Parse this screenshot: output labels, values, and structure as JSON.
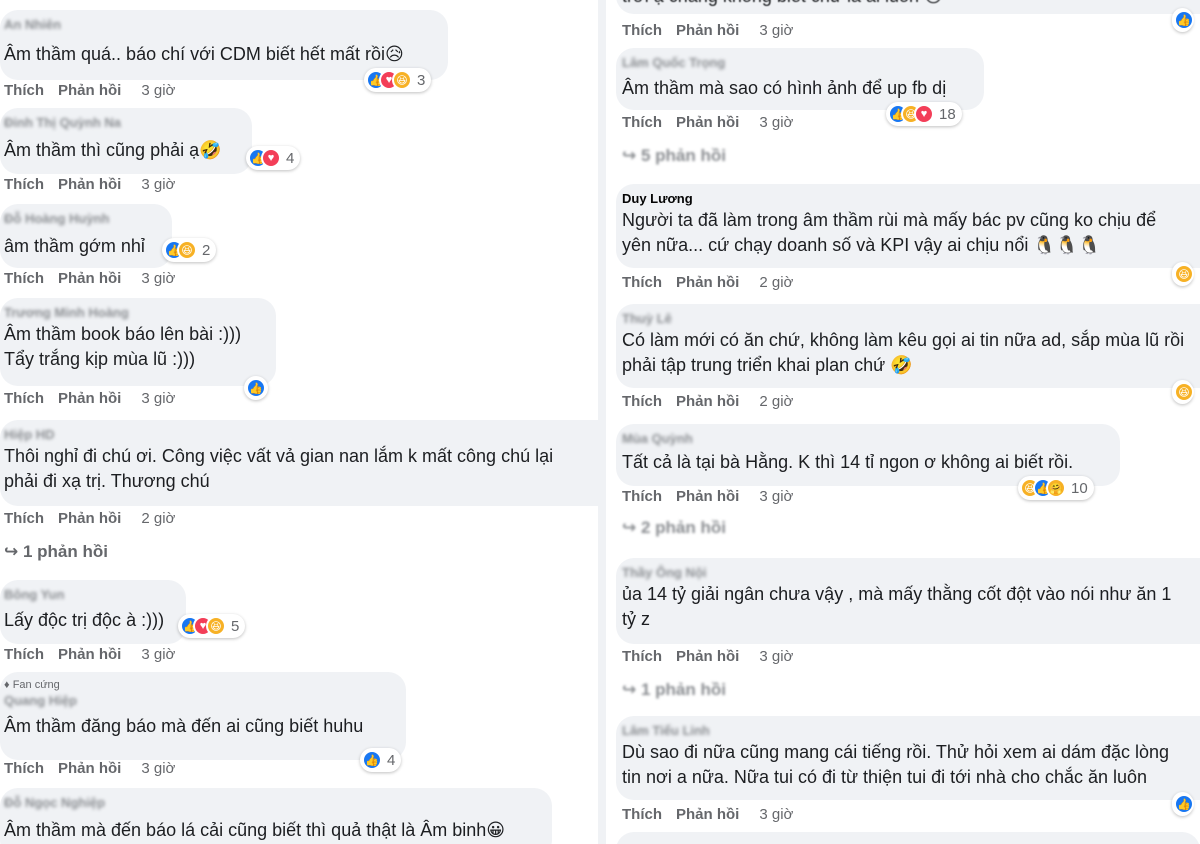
{
  "labels": {
    "like": "Thích",
    "reply": "Phản hồi"
  },
  "left": [
    {
      "name": "An Nhiên",
      "lines": [
        "Âm thầm quá.. báo chí với CDM biết hết mất rồi😥"
      ],
      "time": "3 giờ",
      "reaction_count": "3"
    },
    {
      "name": "Đinh Thị Quỳnh Na",
      "lines": [
        "Âm thầm thì cũng phải ạ🤣"
      ],
      "time": "3 giờ",
      "reaction_count": "4"
    },
    {
      "name": "Đỗ Hoàng Huỳnh",
      "lines": [
        "âm thầm gớm nhỉ"
      ],
      "time": "3 giờ",
      "reaction_count": "2"
    },
    {
      "name": "Trương Minh Hoàng",
      "lines": [
        "Âm thầm book báo lên bài :)))",
        "Tẩy trắng kịp mùa lũ :)))"
      ],
      "time": "3 giờ",
      "reaction_count": ""
    },
    {
      "name": "Hiệp HD",
      "lines": [
        "Thôi nghỉ đi chú ơi. Công việc vất vả gian nan lắm k mất công chú lại",
        "phải đi xạ trị. Thương chú"
      ],
      "time": "2 giờ",
      "reaction_count": ""
    },
    {
      "name": "Bông Yun",
      "lines": [
        "Lấy độc trị độc à :)))"
      ],
      "time": "3 giờ",
      "reaction_count": "5"
    },
    {
      "badge": "Fan cứng",
      "name": "Quang Hiệp",
      "lines": [
        "Âm thầm đăng báo mà đến ai cũng biết huhu"
      ],
      "time": "3 giờ",
      "reaction_count": "4"
    },
    {
      "name": "Đỗ Ngọc Nghiệp",
      "lines": [
        "Âm thầm mà đến báo lá cải cũng biết thì quả thật là Âm binh😀"
      ],
      "time": "",
      "reaction_count": ""
    }
  ],
  "left_replies": "1 phản hồi",
  "right": [
    {
      "name": "",
      "lines": [
        "trời ạ chẳng không biết chứ là ai luôn 😢"
      ],
      "time": "3 giờ",
      "reaction_count": ""
    },
    {
      "name": "Lâm Quốc Trọng",
      "lines": [
        "Âm thầm mà sao có hình ảnh để up fb dị"
      ],
      "time": "3 giờ",
      "reaction_count": "18"
    },
    {
      "name": "Duy Lương",
      "lines": [
        "Người ta đã làm trong âm thầm rùi mà mấy bác pv cũng ko chịu để",
        "yên nữa... cứ chạy doanh số và KPI vậy ai chịu nổi 🐧🐧🐧"
      ],
      "time": "2 giờ",
      "reaction_count": ""
    },
    {
      "name": "Thuỳ Lê",
      "lines": [
        "Có làm mới có ăn chứ, không làm kêu gọi ai tin nữa ad, sắp mùa lũ rồi",
        "phải tập trung triển khai plan chứ 🤣"
      ],
      "time": "2 giờ",
      "reaction_count": ""
    },
    {
      "name": "Mùa Quỳnh",
      "lines": [
        "Tất cả là tại bà Hằng. K thì 14 tỉ ngon ơ không ai biết rồi."
      ],
      "time": "3 giờ",
      "reaction_count": "10"
    },
    {
      "name": "Thầy Ông Nội",
      "lines": [
        "ủa 14 tỷ giải ngân chưa vậy , mà mấy thằng cốt đột vào nói như ăn 1",
        "tỷ z"
      ],
      "time": "3 giờ",
      "reaction_count": ""
    },
    {
      "name": "Lâm Tiểu Linh",
      "lines": [
        "Dù sao đi nữa cũng mang cái tiếng rồi. Thử hỏi xem ai dám đặc lòng",
        "tin nơi a nữa. Nữa tui có đi từ thiện tui đi tới nhà cho chắc ăn luôn"
      ],
      "time": "3 giờ",
      "reaction_count": ""
    }
  ],
  "right_replies": [
    "5 phản hồi",
    "2 phản hồi",
    "1 phản hồi"
  ],
  "colors": {
    "bubble": "#f0f2f5",
    "like": "#1877f2",
    "love": "#f33e58",
    "haha": "#f7b125"
  }
}
